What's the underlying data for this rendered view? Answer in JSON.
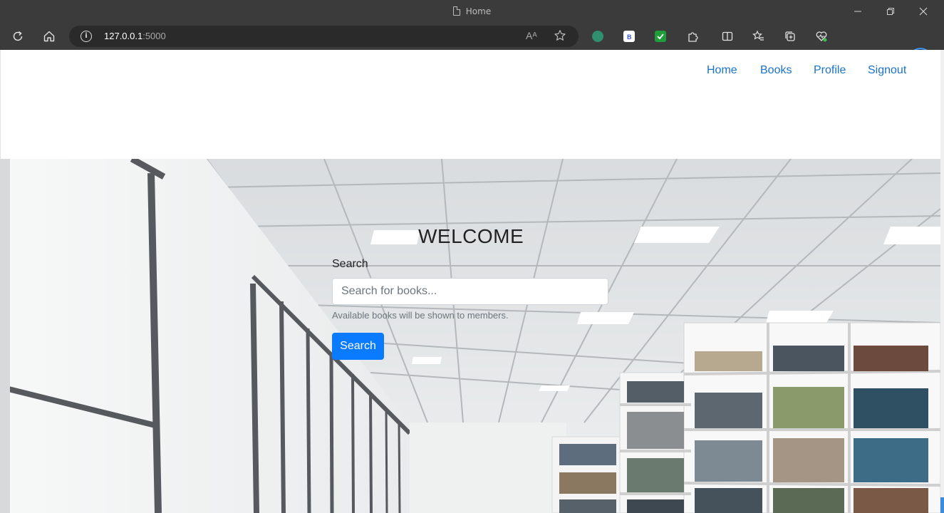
{
  "browser": {
    "tab_title": "Home",
    "url_host": "127.0.0.1",
    "url_port": ":5000",
    "read_aloud_label": "Aᴬ"
  },
  "nav": {
    "home": "Home",
    "books": "Books",
    "profile": "Profile",
    "signout": "Signout"
  },
  "hero": {
    "heading": "WELCOME",
    "search_label": "Search",
    "search_placeholder": "Search for books...",
    "search_value": "",
    "help_text": "Available books will be shown to members.",
    "search_button": "Search"
  },
  "colors": {
    "link": "#1a73c9",
    "primary_button": "#0a7bff",
    "chrome": "#3b3b3b"
  }
}
